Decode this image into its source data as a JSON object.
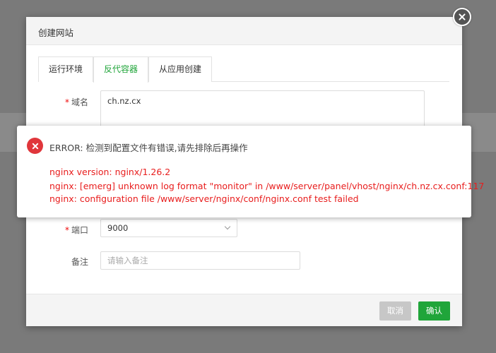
{
  "modal": {
    "title": "创建网站",
    "tabs": [
      {
        "label": "运行环境"
      },
      {
        "label": "反代容器"
      },
      {
        "label": "从应用创建"
      }
    ],
    "domain": {
      "label": "域名",
      "value": "ch.nz.cx"
    },
    "port": {
      "label": "端口",
      "value": "9000"
    },
    "remark": {
      "label": "备注",
      "placeholder": "请输入备注"
    },
    "buttons": {
      "cancel": "取消",
      "confirm": "确认"
    }
  },
  "error_popup": {
    "title": "ERROR: 检测到配置文件有错误,请先排除后再操作",
    "lines": [
      "nginx version: nginx/1.26.2",
      "nginx: [emerg] unknown log format \"monitor\" in /www/server/panel/vhost/nginx/ch.nz.cx.conf:117",
      "nginx: configuration file /www/server/nginx/conf/nginx.conf test failed"
    ]
  },
  "colors": {
    "accent": "#20a53a",
    "error": "#e81d1d",
    "required": "#ef0808"
  }
}
